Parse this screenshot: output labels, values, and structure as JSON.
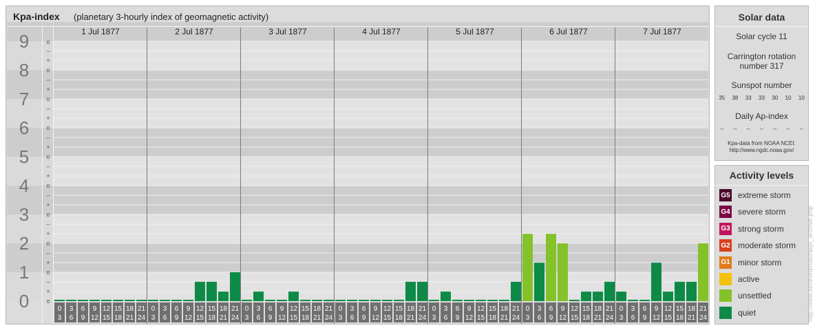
{
  "header": {
    "title": "Kpa-index",
    "subtitle": "(planetary 3-hourly index of geomagnetic activity)"
  },
  "chart_data": {
    "type": "bar",
    "y_levels": [
      "0",
      "1",
      "2",
      "3",
      "4",
      "5",
      "6",
      "7",
      "8",
      "9"
    ],
    "y_sublabels": [
      "+",
      "o",
      "–"
    ],
    "ylim": [
      0,
      9.33
    ],
    "days": [
      "1 Jul 1877",
      "2 Jul 1877",
      "3 Jul 1877",
      "4 Jul 1877",
      "5 Jul 1877",
      "6 Jul 1877",
      "7 Jul 1877"
    ],
    "hour_starts": [
      "0",
      "3",
      "6",
      "9",
      "12",
      "15",
      "18",
      "21"
    ],
    "hour_ends": [
      "3",
      "6",
      "9",
      "12",
      "15",
      "18",
      "21",
      "24"
    ],
    "values": [
      0,
      0,
      0,
      0,
      0,
      0,
      0,
      0,
      0,
      0,
      0,
      0,
      0.67,
      0.67,
      0.33,
      1,
      0,
      0.33,
      0,
      0,
      0.33,
      0,
      0,
      0,
      0,
      0,
      0,
      0,
      0,
      0,
      0.67,
      0.67,
      0,
      0.33,
      0,
      0,
      0,
      0,
      0,
      0.67,
      2.33,
      1.33,
      2.33,
      2,
      0,
      0.33,
      0.33,
      0.67,
      0.33,
      0,
      0,
      1.33,
      0.33,
      0.67,
      0.67,
      2
    ],
    "colors": {
      "quiet": "#0e8a47",
      "unsettled": "#84c22a",
      "active": "#f4c20e",
      "g1": "#e07b1b",
      "g2": "#d8411e",
      "g3": "#c0155e",
      "g4": "#7b0a45",
      "g5": "#4a0a2a"
    }
  },
  "solar": {
    "title": "Solar data",
    "cycle": "Solar cycle 11",
    "carrington_line1": "Carrington rotation",
    "carrington_line2": "number 317",
    "sunspot_title": "Sunspot number",
    "sunspots": [
      "35",
      "38",
      "33",
      "33",
      "30",
      "10",
      "10"
    ],
    "ap_title": "Daily Ap-index",
    "ap_values": [
      "--",
      "--",
      "--",
      "--",
      "--",
      "--",
      "--"
    ],
    "credit_line1": "Kpa-data from NOAA NCEI:",
    "credit_line2": "http://www.ngdc.noaa.gov/"
  },
  "activity": {
    "title": "Activity levels",
    "levels": [
      {
        "badge": "G5",
        "label": "extreme storm",
        "color": "#4a0a2a"
      },
      {
        "badge": "G4",
        "label": "severe storm",
        "color": "#7b0a45"
      },
      {
        "badge": "G3",
        "label": "strong storm",
        "color": "#c0155e"
      },
      {
        "badge": "G2",
        "label": "moderate storm",
        "color": "#d8411e"
      },
      {
        "badge": "G1",
        "label": "minor storm",
        "color": "#e07b1b"
      },
      {
        "badge": "",
        "label": "active",
        "color": "#f4c20e"
      },
      {
        "badge": "",
        "label": "unsettled",
        "color": "#84c22a"
      },
      {
        "badge": "",
        "label": "quiet",
        "color": "#0e8a47"
      }
    ]
  },
  "watermark": "http://www.tiesevelenaturakjo_archive.php"
}
